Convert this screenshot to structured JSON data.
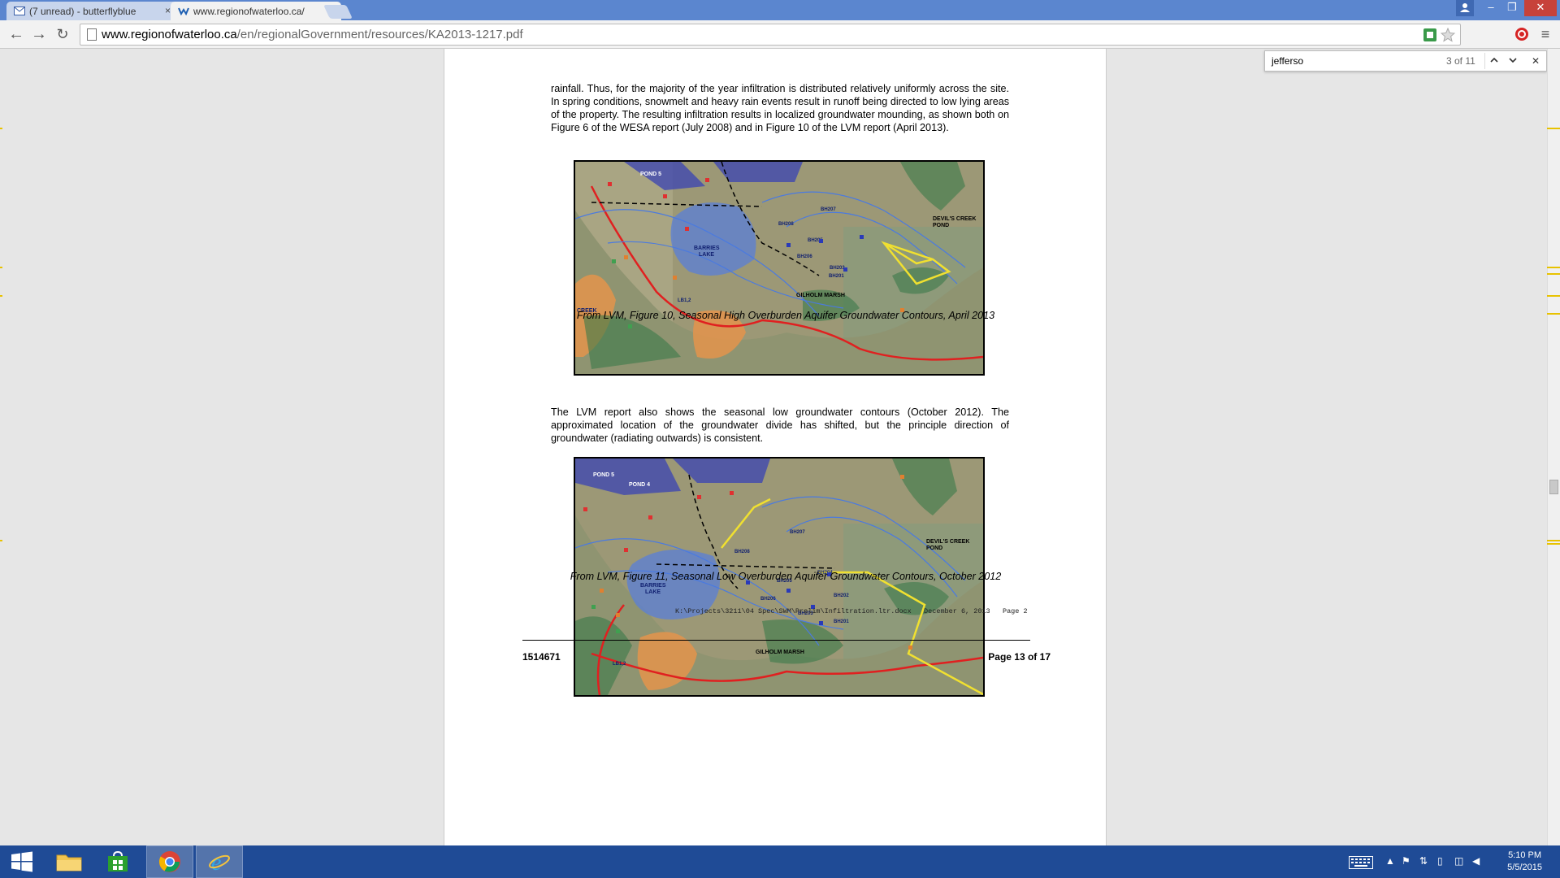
{
  "browser": {
    "tabs": [
      {
        "label": "(7 unread) - butterflyblue",
        "close": "×"
      },
      {
        "label": "www.regionofwaterloo.ca/",
        "close": "×"
      }
    ],
    "url_host": "www.regionofwaterloo.ca",
    "url_path": "/en/regionalGovernment/resources/KA2013-1217.pdf",
    "menu_icon": "hamburger-icon"
  },
  "find": {
    "query": "jefferso",
    "count": "3 of 11"
  },
  "document": {
    "para1": "rainfall. Thus, for the majority of the year infiltration is distributed relatively uniformly across the site. In spring conditions, snowmelt and heavy rain events result in runoff being directed to low lying areas of the property. The resulting infiltration results in localized groundwater mounding, as shown both on Figure 6 of the WESA report (July 2008) and in Figure 10 of the LVM report (April 2013).",
    "caption1": "From LVM, Figure 10, Seasonal High Overburden Aquifer Groundwater Contours, April 2013",
    "para2": "The LVM report also shows the seasonal low groundwater contours (October 2012). The approximated location of the groundwater divide has shifted, but the principle direction of groundwater (radiating outwards) is consistent.",
    "caption2": "From LVM, Figure 11, Seasonal Low Overburden Aquifer Groundwater Contours, October 2012",
    "footer_path": "K:\\Projects\\3211\\04 Spec\\SWM\\Prelim\\Infiltration.ltr.docx   December 6, 2013   Page 2",
    "doc_number": "1514671",
    "page_of": "Page 13 of 17"
  },
  "map1": {
    "labels": {
      "barries": "BARRIES",
      "lake": "LAKE",
      "devils1": "DEVIL'S CREEK",
      "devils2": "POND",
      "gilholm": "GILHOLM MARSH",
      "creek": "CREEK",
      "pond5": "POND 5",
      "bh201": "BH201",
      "bh203": "BH203",
      "bh205": "BH205",
      "bh206": "BH206",
      "bh207": "BH207",
      "bh208": "BH208",
      "lb12": "LB1,2"
    }
  },
  "map2": {
    "labels": {
      "barries": "BARRIES",
      "lake": "LAKE",
      "devils1": "DEVIL'S CREEK",
      "devils2": "POND",
      "gilholm": "GILHOLM MARSH",
      "pond5": "POND 5",
      "pond4": "POND 4",
      "bh201": "BH201",
      "bh202": "BH202",
      "bh203": "BH203",
      "bh204": "BH204",
      "bh205": "BH205",
      "bh206": "BH206",
      "bh207": "BH207",
      "bh208": "BH208",
      "lb12": "LB1,2"
    }
  },
  "taskbar": {
    "time": "5:10 PM",
    "date": "5/5/2015"
  }
}
